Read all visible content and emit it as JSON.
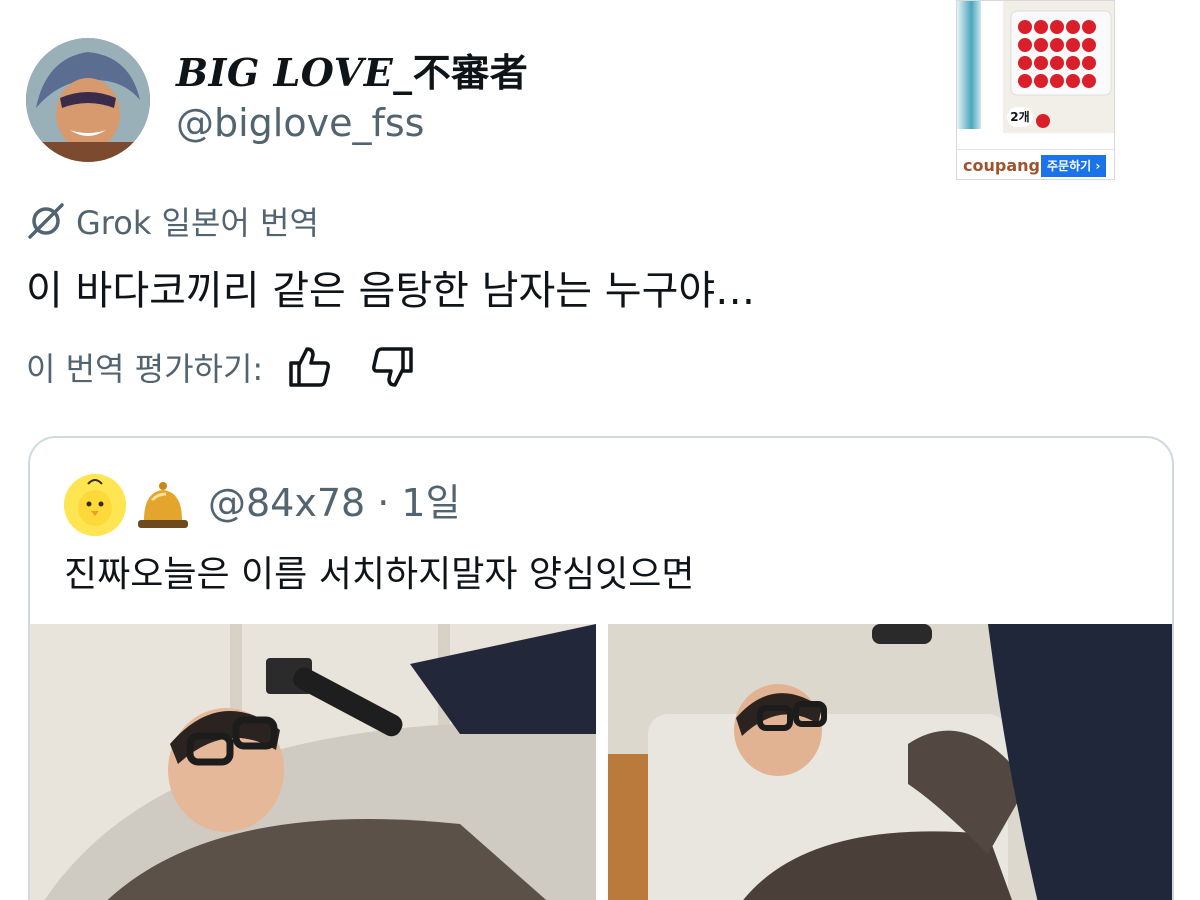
{
  "author": {
    "display_name_latin": "BIG LOVE_",
    "display_name_cjk": "不審者",
    "handle": "@biglove_fss"
  },
  "ad": {
    "quantity_badge": "2개",
    "brand": "coupang",
    "cta": "주문하기 ›"
  },
  "translation": {
    "source_label": "Grok 일본어 번역",
    "text": "이 바다코끼리 같은 음탕한 남자는 누구야…",
    "rate_label": "이 번역 평가하기:",
    "icons": {
      "grok": "grok-logo-icon",
      "up": "thumbs-up-icon",
      "down": "thumbs-down-icon"
    }
  },
  "quote": {
    "meta": "@84x78 · 1일",
    "text": "진짜오늘은 이름 서치하지말자 양심잇으면",
    "icons": {
      "avatar": "chick-avatar",
      "bell": "bell-emoji"
    }
  },
  "colors": {
    "text_primary": "#0f1419",
    "text_secondary": "#536471",
    "border": "#cfd9de",
    "ad_button": "#1a73e8"
  }
}
